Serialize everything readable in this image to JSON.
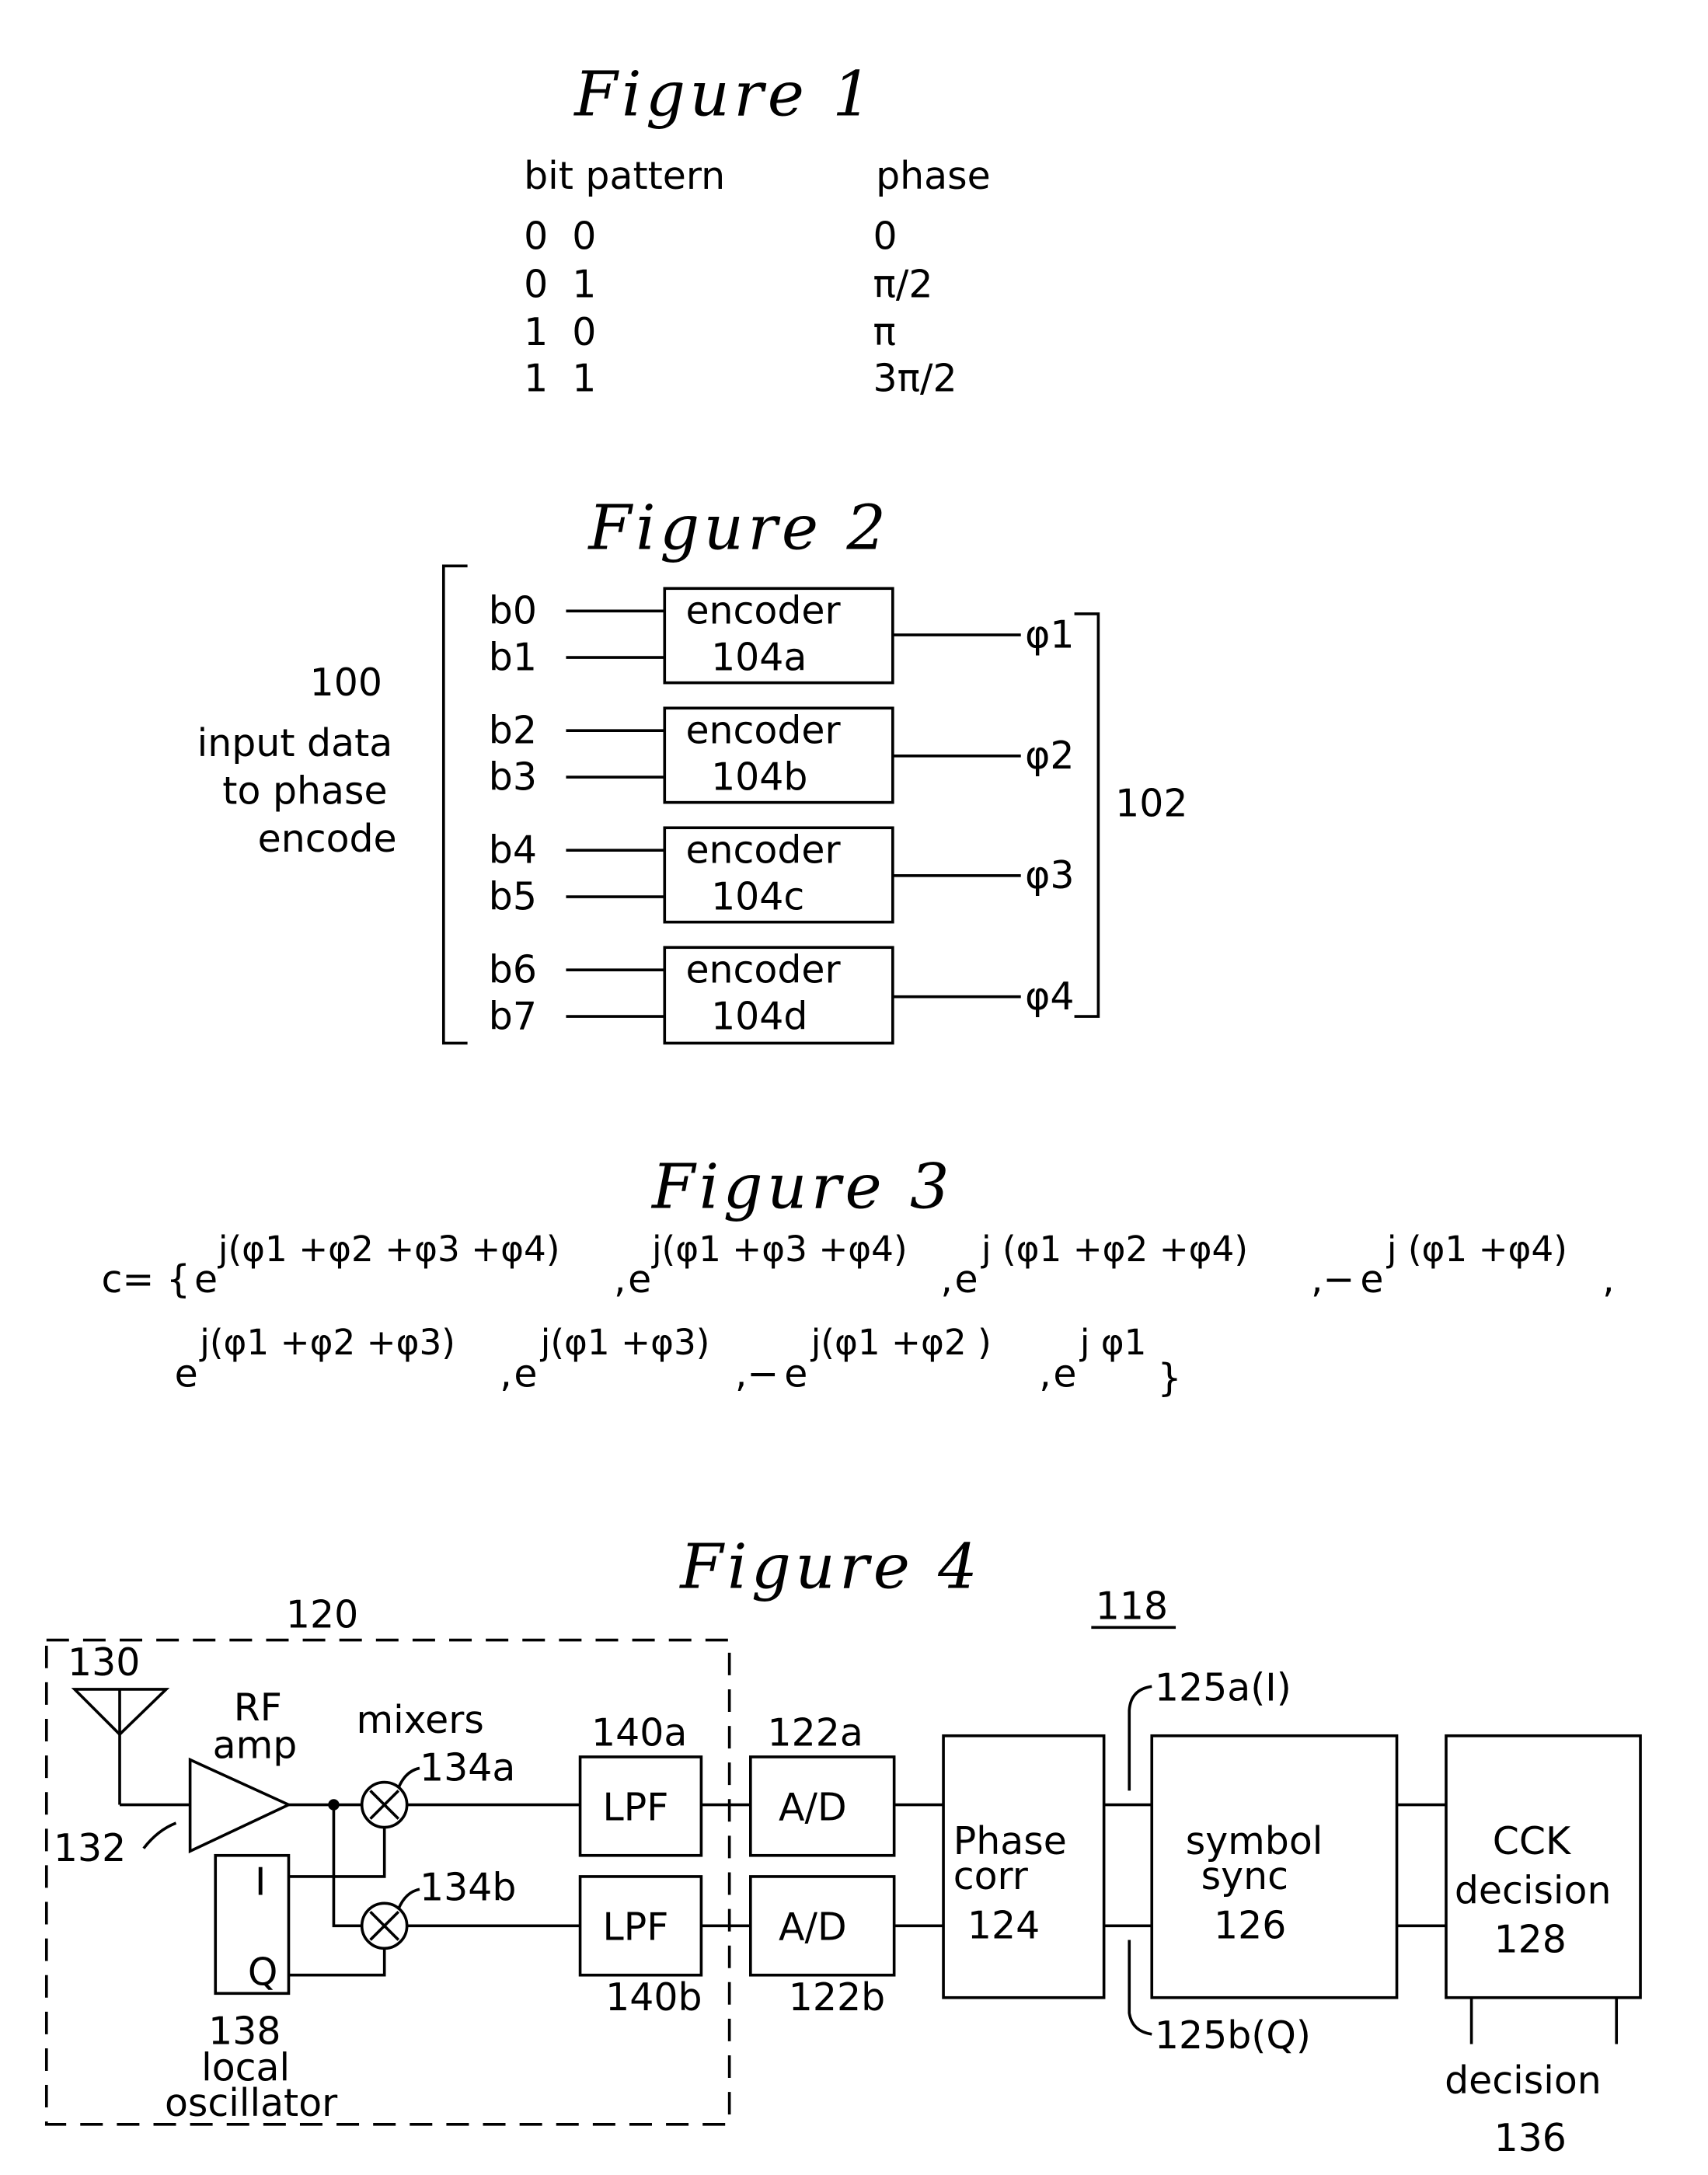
{
  "figure1": {
    "title": "Figure 1",
    "headers": {
      "bit_pattern": "bit pattern",
      "phase": "phase"
    },
    "rows": [
      {
        "bits": "0  0",
        "phase": "0"
      },
      {
        "bits": "0  1",
        "phase": "π/2"
      },
      {
        "bits": "1  0",
        "phase": "π"
      },
      {
        "bits": "1  1",
        "phase": "3π/2"
      }
    ]
  },
  "figure2": {
    "title": "Figure 2",
    "input_ref": "100",
    "input_label": [
      "input data",
      "to phase",
      "encode"
    ],
    "output_ref": "102",
    "encoders": [
      {
        "name": "encoder",
        "ref": "104a",
        "inputs": [
          "b0",
          "b1"
        ],
        "output": "φ1"
      },
      {
        "name": "encoder",
        "ref": "104b",
        "inputs": [
          "b2",
          "b3"
        ],
        "output": "φ2"
      },
      {
        "name": "encoder",
        "ref": "104c",
        "inputs": [
          "b4",
          "b5"
        ],
        "output": "φ3"
      },
      {
        "name": "encoder",
        "ref": "104d",
        "inputs": [
          "b6",
          "b7"
        ],
        "output": "φ4"
      }
    ]
  },
  "figure3": {
    "title": "Figure 3",
    "prefix": "c= {",
    "line1": [
      {
        "sign": "",
        "exp": "j(φ1 +φ2 +φ3 +φ4)"
      },
      {
        "sign": ",",
        "exp": "j(φ1 +φ3 +φ4)"
      },
      {
        "sign": ",",
        "exp": "j (φ1 +φ2 +φ4)"
      },
      {
        "sign": ",−",
        "exp": "j (φ1 +φ4)"
      }
    ],
    "line2": [
      {
        "sign": "",
        "exp": "j(φ1 +φ2 +φ3)"
      },
      {
        "sign": ",",
        "exp": "j(φ1 +φ3)"
      },
      {
        "sign": ",−",
        "exp": "j(φ1 +φ2 )"
      },
      {
        "sign": ",",
        "exp": "j φ1"
      }
    ],
    "base": "e",
    "line1_trail": ",",
    "suffix": "}"
  },
  "figure4": {
    "title": "Figure 4",
    "system_ref": "118",
    "frontend_ref": "120",
    "antenna_ref": "130",
    "rf_amp_label": [
      "RF",
      "amp"
    ],
    "rf_amp_ref": "132",
    "mixers_label": "mixers",
    "mixer_a_ref": "134a",
    "mixer_b_ref": "134b",
    "lo_ref": "138",
    "lo_label": [
      "local",
      "oscillator"
    ],
    "lo_ports": {
      "i": "I",
      "q": "Q"
    },
    "lpf_label": "LPF",
    "lpf_a_ref": "140a",
    "lpf_b_ref": "140b",
    "adc_label": "A/D",
    "adc_a_ref": "122a",
    "adc_b_ref": "122b",
    "phase_corr_label": [
      "Phase",
      "corr",
      "124"
    ],
    "path_i_ref": "125a(I)",
    "path_q_ref": "125b(Q)",
    "symbol_sync_label": [
      "symbol",
      "sync",
      "126"
    ],
    "cck_label": [
      "CCK",
      "decision",
      "128"
    ],
    "decision_label": "decision",
    "decision_ref": "136"
  }
}
